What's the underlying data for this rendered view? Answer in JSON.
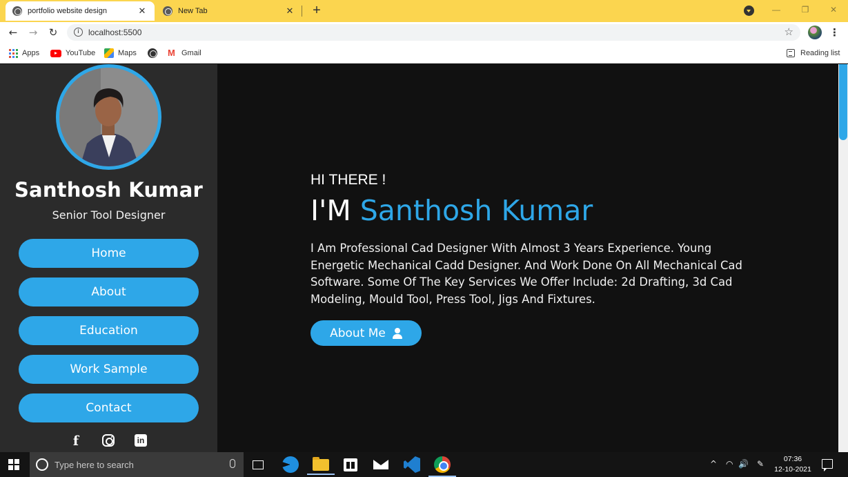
{
  "browser": {
    "tabs": [
      {
        "title": "portfolio website design",
        "close": "✕"
      },
      {
        "title": "New Tab",
        "close": "✕"
      }
    ],
    "new_tab": "+",
    "window_controls": {
      "minimize": "—",
      "restore": "❐",
      "close": "✕"
    },
    "nav": {
      "back": "←",
      "forward": "→",
      "reload": "↻"
    },
    "url": "localhost:5500",
    "info_icon": "i",
    "star": "☆",
    "menu": "⋮",
    "bookmarks": [
      {
        "label": "Apps",
        "icon": "apps-grid-icon"
      },
      {
        "label": "YouTube",
        "icon": "youtube-icon"
      },
      {
        "label": "Maps",
        "icon": "maps-icon"
      },
      {
        "label": "",
        "icon": "globe-icon"
      },
      {
        "label": "Gmail",
        "icon": "gmail-icon"
      }
    ],
    "reading_list": "Reading list"
  },
  "sidebar": {
    "name": "Santhosh Kumar",
    "role": "Senior Tool Designer",
    "nav": [
      "Home",
      "About",
      "Education",
      "Work Sample",
      "Contact"
    ],
    "socials": {
      "facebook": "f",
      "instagram": "",
      "linkedin": "in"
    }
  },
  "hero": {
    "greeting": "HI THERE !",
    "prefix": "I'M ",
    "name": "Santhosh Kumar",
    "bio": "I Am Professional Cad Designer With Almost 3 Years Experience. Young Energetic Mechanical Cadd Designer. And Work Done On All Mechanical Cad Software. Some Of The Key Services We Offer Include: 2d Drafting, 3d Cad Modeling, Mould Tool, Press Tool, Jigs And Fixtures.",
    "button": "About Me"
  },
  "taskbar": {
    "search_placeholder": "Type here to search",
    "tray": {
      "chevron": "^",
      "wifi": "◠",
      "volume": "🔊",
      "pen": "✎"
    },
    "time": "07:36",
    "date": "12-10-2021"
  },
  "colors": {
    "accent": "#2ea7e8",
    "sidebar": "#2b2b2b",
    "main_bg": "#111111",
    "tab_strip": "#fbd54f"
  }
}
